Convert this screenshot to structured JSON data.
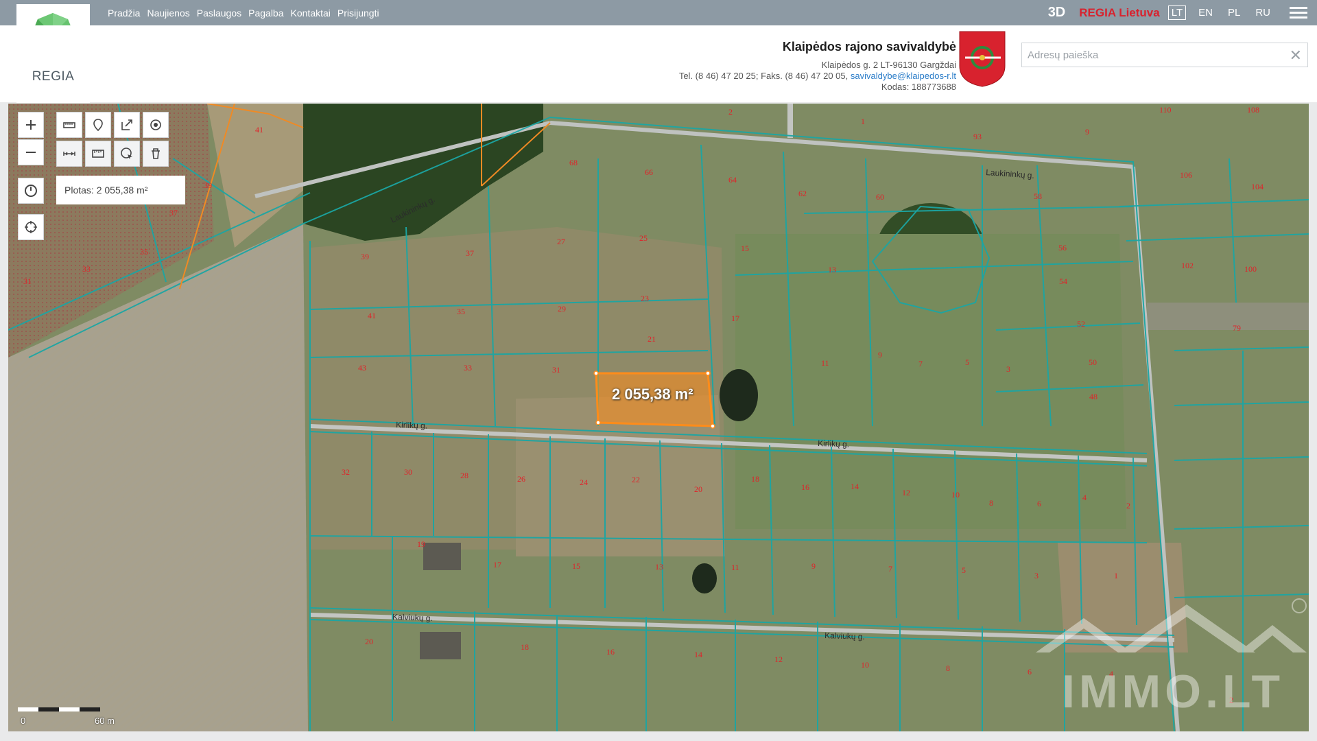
{
  "app": {
    "name": "REGIA"
  },
  "nav": {
    "items": [
      "Pradžia",
      "Naujienos",
      "Paslaugos",
      "Pagalba",
      "Kontaktai",
      "Prisijungti"
    ]
  },
  "topbar": {
    "btn_3d": "3D",
    "regia_lietuva": "REGIA Lietuva",
    "languages": [
      "LT",
      "EN",
      "PL",
      "RU"
    ],
    "active_language": "LT"
  },
  "municipality": {
    "name": "Klaipėdos rajono savivaldybė",
    "address": "Klaipėdos g. 2 LT-96130 Gargždai",
    "phones": "Tel. (8 46) 47 20 25; Faks. (8 46) 47 20 05,",
    "email": "savivaldybe@klaipedos-r.lt",
    "code": "Kodas: 188773688"
  },
  "search": {
    "placeholder": "Adresų paieška",
    "value": ""
  },
  "tooltip": {
    "text": "Plotas: 2 055,38 m²"
  },
  "map": {
    "measurement": "2 055,38 m²",
    "scale": {
      "zero": "0",
      "label": "60 m"
    },
    "streets": [
      "Laukininkų g.",
      "Laukininkų g.",
      "Kirlikų g.",
      "Kirlikų g.",
      "Kalviukų g.",
      "Kalviukų g."
    ],
    "parcels": [
      "41",
      "39",
      "37",
      "35",
      "33",
      "31",
      "2",
      "1",
      "93",
      "110",
      "9",
      "108",
      "68",
      "66",
      "64",
      "62",
      "60",
      "58",
      "106",
      "104",
      "27",
      "25",
      "15",
      "13",
      "56",
      "102",
      "100",
      "39",
      "37",
      "41",
      "35",
      "29",
      "23",
      "17",
      "54",
      "52",
      "43",
      "33",
      "31",
      "21",
      "11",
      "9",
      "7",
      "5",
      "3",
      "50",
      "48",
      "79",
      "32",
      "30",
      "28",
      "26",
      "24",
      "22",
      "20",
      "18",
      "16",
      "14",
      "12",
      "10",
      "8",
      "6",
      "4",
      "2",
      "19",
      "17",
      "15",
      "13",
      "11",
      "9",
      "7",
      "5",
      "3",
      "1",
      "20",
      "18",
      "16",
      "14",
      "12",
      "10",
      "8",
      "6",
      "4",
      "2",
      "19"
    ],
    "watermark": "IMMO.LT"
  },
  "colors": {
    "topbar": "#8d9aa4",
    "parcel_line": "#1ba6a4",
    "parcel_number": "#e0232a",
    "measure": "#ff8c1a",
    "logo_green": "#4fb85a",
    "coat_red": "#d8222e"
  }
}
